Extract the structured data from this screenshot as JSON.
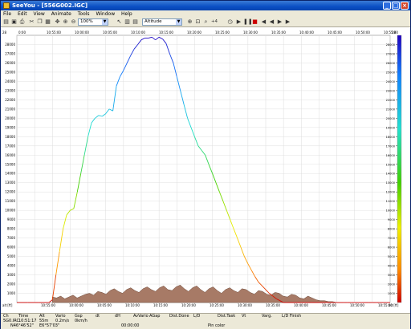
{
  "window": {
    "title": "SeeYou - [556G002.IGC]",
    "buttons": [
      "_",
      "□",
      "×"
    ]
  },
  "menu": [
    "File",
    "Edit",
    "View",
    "Animate",
    "Tools",
    "Window",
    "Help"
  ],
  "toolbar": {
    "zoom_value": "100%",
    "channel_value": "Altitude",
    "speed_label": "+4"
  },
  "chart_data": {
    "type": "line",
    "y_left_ticks": [
      1000,
      2000,
      3000,
      4000,
      5000,
      6000,
      7000,
      8000,
      9000,
      10000,
      11000,
      12000,
      13000,
      14000,
      15000,
      16000,
      17000,
      18000,
      19000,
      20000,
      21000,
      22000,
      23000,
      24000,
      25000,
      26000,
      27000,
      28000
    ],
    "y_right_ticks": [
      1000,
      2000,
      3000,
      4000,
      5000,
      6000,
      7000,
      8000,
      9000,
      10000,
      11000,
      12000,
      13000,
      14000,
      15000,
      16000,
      17000,
      18000,
      19000,
      20000,
      21000,
      22000,
      23000,
      24000,
      25000,
      26000,
      27000,
      28000
    ],
    "y_left_unit": "alt [ft]",
    "y_right_unit": "alt [ft]",
    "y_top_label_left": "28",
    "y_top_label_right": "28",
    "ylim": [
      0,
      29000
    ],
    "x_ticks": [
      "10:00:00",
      "10:05:00",
      "10:10:00",
      "10:15:00",
      "10:20:00",
      "10:25:00",
      "10:30:00",
      "10:35:00",
      "10:40:00",
      "10:45:00",
      "10:50:00",
      "10:55:00",
      "11:00:00",
      "11:05:00",
      "11:10:00",
      "11:15:00",
      "11:20:00",
      "11:25:00",
      "11:30:00",
      "11:35:00",
      "11:40:00",
      "11:45:00",
      "11:50:00",
      "11:55:00",
      "12:00:00"
    ],
    "x_top_ticks": [
      "0:00",
      "10:55:00",
      "10:00:00",
      "10:05:00",
      "10:10:00",
      "10:15:00",
      "10:20:00",
      "10:25:00",
      "10:30:00",
      "10:35:00",
      "10:40:00",
      "10:45:00",
      "10:50:00",
      "10:55:00"
    ],
    "x_bottom_ticks": [
      "10:55:00",
      "10:00:00",
      "10:05:00",
      "10:10:00",
      "10:15:00",
      "10:20:00",
      "10:25:00",
      "10:30:00",
      "10:35:00",
      "10:40:00",
      "10:45:00",
      "10:50:00",
      "10:55:00"
    ],
    "altitude_series": {
      "name": "Altitude",
      "x_minutes": [
        0,
        3,
        6,
        9,
        10,
        11,
        12,
        13,
        14,
        15,
        16,
        17,
        18,
        19,
        20,
        21,
        22,
        23,
        24,
        25,
        26,
        27,
        28,
        29,
        30,
        31,
        32,
        33,
        34,
        35,
        36,
        37,
        38,
        39,
        40,
        41,
        42,
        43,
        44,
        45,
        46,
        47,
        48,
        49,
        50,
        51,
        52,
        53,
        54,
        55,
        56,
        57,
        58,
        59,
        60,
        61,
        62,
        63,
        64,
        65,
        66,
        67,
        68,
        69,
        70,
        71,
        72,
        73,
        74,
        75,
        76,
        77,
        78,
        79,
        80,
        81,
        82,
        83,
        84,
        85,
        86,
        87,
        88,
        89,
        90,
        91,
        92,
        93,
        94,
        95,
        96,
        97,
        98,
        99,
        100,
        101,
        102,
        103,
        104,
        105
      ],
      "values": [
        0,
        0,
        0,
        0,
        300,
        3000,
        5500,
        8000,
        9500,
        10000,
        10200,
        12000,
        14000,
        16000,
        18000,
        19500,
        20000,
        20300,
        20200,
        20500,
        21000,
        20800,
        23500,
        24500,
        25200,
        26000,
        26800,
        27500,
        28000,
        28500,
        28700,
        28700,
        28800,
        28500,
        28800,
        28600,
        28100,
        27000,
        26000,
        24500,
        23000,
        21500,
        20000,
        19000,
        18000,
        17000,
        16500,
        16000,
        15000,
        14000,
        13000,
        12000,
        11000,
        10000,
        9000,
        8000,
        7000,
        6000,
        5000,
        4200,
        3500,
        2800,
        2200,
        1800,
        1400,
        1000,
        700,
        400,
        200,
        0,
        0,
        0,
        0,
        0,
        0,
        0,
        0,
        0,
        0,
        0,
        0,
        0,
        0,
        0,
        0,
        0,
        0,
        0,
        0,
        0,
        0,
        0,
        0,
        0,
        0,
        0,
        0,
        0,
        0,
        0
      ]
    },
    "ground_series": {
      "name": "Ground",
      "values": [
        600,
        500,
        700,
        400,
        600,
        800,
        500,
        700,
        900,
        1000,
        800,
        1200,
        1100,
        900,
        1300,
        1500,
        1200,
        1000,
        1400,
        1600,
        1300,
        1100,
        1500,
        1700,
        1400,
        1200,
        1600,
        1800,
        1400,
        1300,
        1700,
        1900,
        1500,
        1200,
        1600,
        1800,
        1400,
        1100,
        1500,
        1700,
        1300,
        1000,
        1400,
        1600,
        1300,
        1100,
        1500,
        1400,
        1100,
        900,
        1300,
        1200,
        900,
        800,
        1100,
        1000,
        700,
        600,
        900,
        800,
        500,
        400,
        700,
        500,
        300,
        200,
        200,
        100,
        100,
        0
      ]
    }
  },
  "status": {
    "headers": [
      "Ch",
      "Time",
      "Alt",
      "Vario",
      "Gsp",
      "dt",
      "dH",
      "AvVario",
      "AGap",
      "Dist.Done",
      "L/D",
      "Dist.Task",
      "Vt",
      "Varg.",
      "L/D Finish"
    ],
    "row1": [
      "5G0.IRC",
      "10:51:17",
      "55m",
      "0.2m/s",
      "0km/h"
    ],
    "row2": [
      "N46°46'52\"",
      "E6°57'03\"",
      "00:00:00",
      "Pin color"
    ]
  }
}
